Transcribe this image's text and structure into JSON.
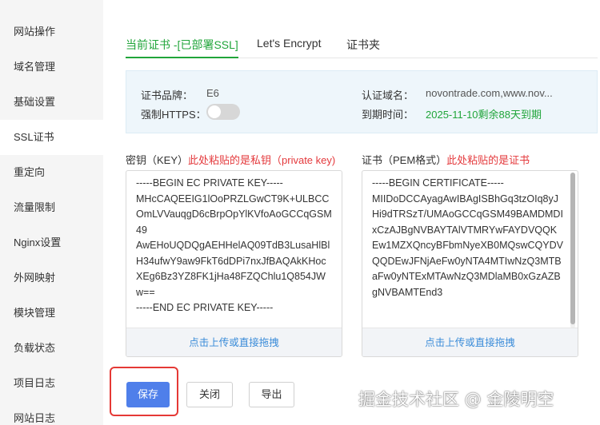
{
  "sidebar": {
    "items": [
      {
        "label": "网站操作"
      },
      {
        "label": "域名管理"
      },
      {
        "label": "基础设置"
      },
      {
        "label": "SSL证书"
      },
      {
        "label": "重定向"
      },
      {
        "label": "流量限制"
      },
      {
        "label": "Nginx设置"
      },
      {
        "label": "外网映射"
      },
      {
        "label": "模块管理"
      },
      {
        "label": "负载状态"
      },
      {
        "label": "项目日志"
      },
      {
        "label": "网站日志"
      }
    ],
    "active": "SSL证书"
  },
  "tabs": [
    {
      "label": "当前证书 -[已部署SSL]"
    },
    {
      "label": "Let's Encrypt"
    },
    {
      "label": "证书夹"
    }
  ],
  "info": {
    "brand_label": "证书品牌：",
    "brand_value": "E6",
    "https_label": "强制HTTPS：",
    "domain_label": "认证域名：",
    "domain_value": "novontrade.com,www.nov...",
    "expire_label": "到期时间：",
    "expire_value": "2025-11-10剩余88天到期"
  },
  "key_panel": {
    "title": "密钥（KEY）",
    "warning": "此处粘贴的是私钥（private key)",
    "content": "-----BEGIN EC PRIVATE KEY-----\nMHcCAQEEIG1lOoPRZLGwCT9K+ULBCCOmLVVauqgD6cBrpOpYlKVfoAoGCCqGSM49\nAwEHoUQDQgAEHHelAQ09TdB3LusaHlBlH34ufwY9aw9FkT6dDPi7nxJfBAQAkKHocXEg6Bz3YZ8FK1jHa48FZQChlu1Q854JWw==\n-----END EC PRIVATE KEY-----",
    "upload": "点击上传或直接拖拽"
  },
  "cert_panel": {
    "title": "证书（PEM格式）",
    "warning": "此处粘贴的是证书",
    "content": "-----BEGIN CERTIFICATE-----\nMIIDoDCCAyagAwIBAgISBhGq3tzOIq8yJHi9dTRSzT/UMAoGCCqGSM49BAMDMDIxCzAJBgNVBAYTAlVTMRYwFAYDVQQKEw1MZXQncyBFbmNyeXB0MQswCQYDVQQDEwJFNjAeFw0yNTA4MTIwNzQ3MTBaFw0yNTExMTAwNzQ3MDlaMB0xGzAZBgNVBAMTEnd3",
    "upload": "点击上传或直接拖拽"
  },
  "buttons": {
    "save": "保存",
    "close": "关闭",
    "export": "导出"
  },
  "watermark": "掘金技术社区 @ 金陵明空",
  "colors": {
    "accent": "#20a53a",
    "primary_button": "#4f7fea",
    "warning": "#e4393c",
    "link": "#3b8cd9"
  }
}
